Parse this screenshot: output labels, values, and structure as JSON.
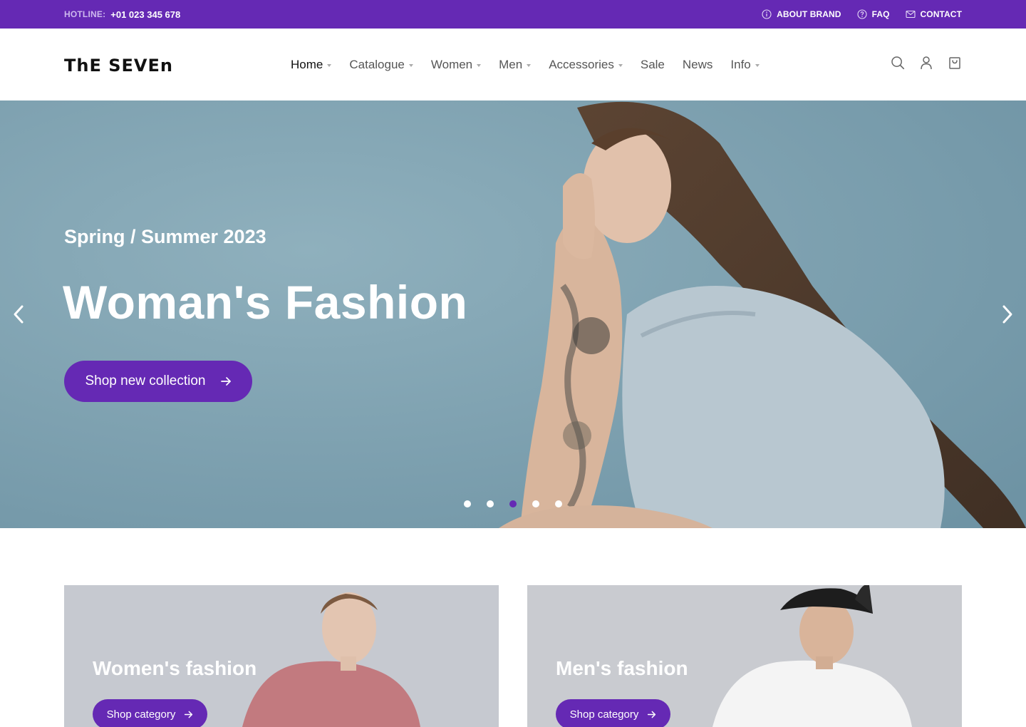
{
  "topbar": {
    "hotline_label": "HOTLINE:",
    "hotline_number": "+01 023 345 678",
    "links": [
      {
        "label": "ABOUT BRAND",
        "icon": "info-icon"
      },
      {
        "label": "FAQ",
        "icon": "question-icon"
      },
      {
        "label": "CONTACT",
        "icon": "mail-icon"
      }
    ]
  },
  "header": {
    "logo": "ThE SEVEn",
    "nav": [
      {
        "label": "Home",
        "has_caret": true,
        "active": true
      },
      {
        "label": "Catalogue",
        "has_caret": true
      },
      {
        "label": "Women",
        "has_caret": true
      },
      {
        "label": "Men",
        "has_caret": true
      },
      {
        "label": "Accessories",
        "has_caret": true
      },
      {
        "label": "Sale",
        "has_caret": false
      },
      {
        "label": "News",
        "has_caret": false
      },
      {
        "label": "Info",
        "has_caret": true
      }
    ],
    "icons": [
      "search-icon",
      "user-icon",
      "cart-icon"
    ]
  },
  "hero": {
    "subtitle": "Spring / Summer 2023",
    "title": "Woman's Fashion",
    "cta_label": "Shop new collection",
    "slides_total": 5,
    "active_slide": 3
  },
  "categories": [
    {
      "title": "Women's fashion",
      "button_label": "Shop category"
    },
    {
      "title": "Men's fashion",
      "button_label": "Shop category"
    }
  ],
  "colors": {
    "accent": "#6529b4",
    "hero_bg": "#7b9fae",
    "banner_bg": "#c7cad1"
  }
}
